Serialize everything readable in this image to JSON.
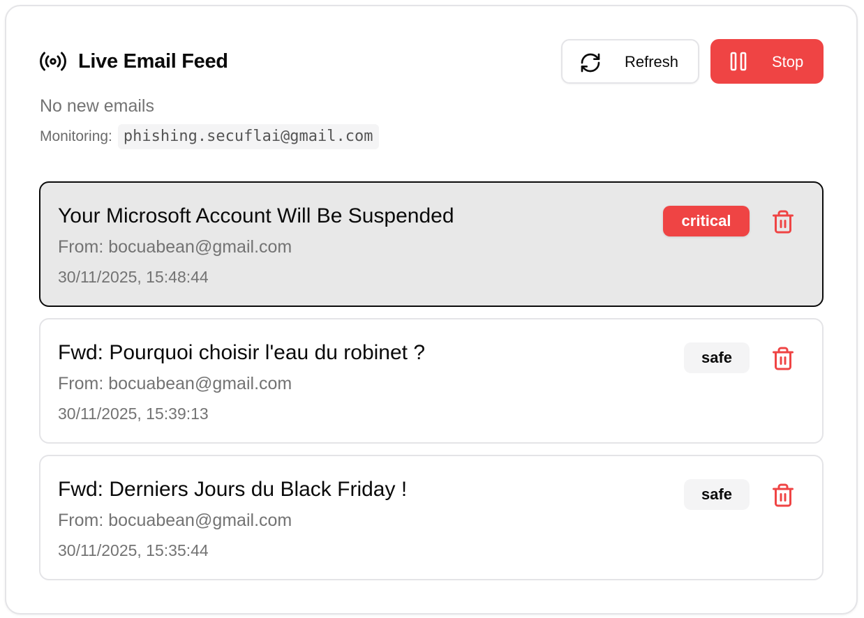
{
  "header": {
    "title": "Live Email Feed",
    "title_icon": "radio-broadcast-icon",
    "refresh_label": "Refresh",
    "stop_label": "Stop"
  },
  "status": {
    "text": "No new emails",
    "monitoring_label": "Monitoring:",
    "monitoring_address": "phishing.secuflai@gmail.com"
  },
  "emails": [
    {
      "subject": "Your Microsoft Account Will Be Suspended",
      "from": "From: bocuabean@gmail.com",
      "date": "30/11/2025, 15:48:44",
      "badge": "critical"
    },
    {
      "subject": "Fwd: Pourquoi choisir l'eau du robinet ?",
      "from": "From: bocuabean@gmail.com",
      "date": "30/11/2025, 15:39:13",
      "badge": "safe"
    },
    {
      "subject": "Fwd: Derniers Jours du Black Friday !",
      "from": "From: bocuabean@gmail.com",
      "date": "30/11/2025, 15:35:44",
      "badge": "safe"
    }
  ],
  "colors": {
    "danger": "#ef4444",
    "muted_text": "#737373",
    "border": "#e4e4e7",
    "selected_bg": "#e8e8e8"
  }
}
